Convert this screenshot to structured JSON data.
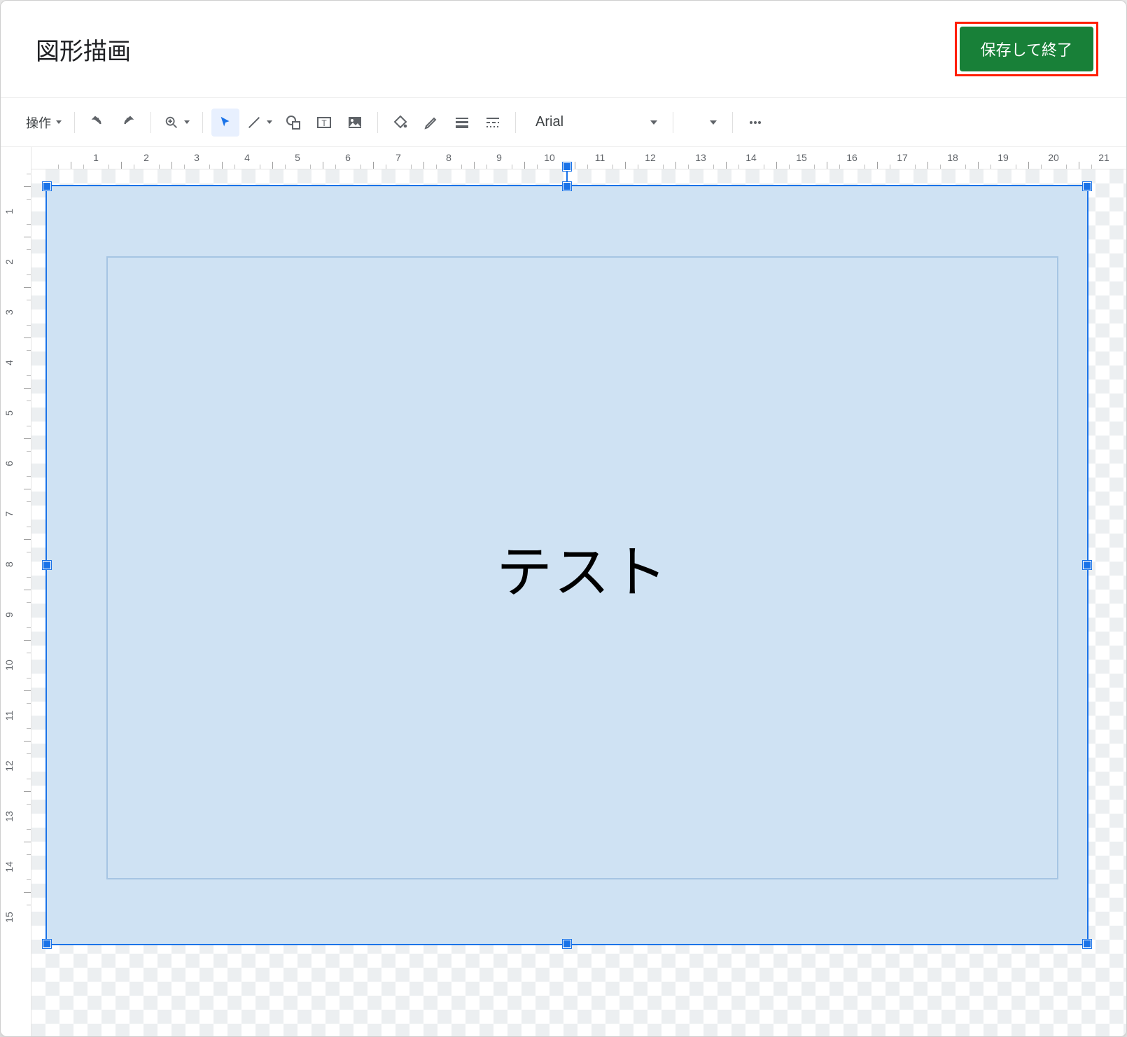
{
  "dialog": {
    "title": "図形描画",
    "save_button": "保存して終了"
  },
  "toolbar": {
    "actions_label": "操作",
    "font_name": "Arial"
  },
  "ruler": {
    "h_labels": [
      "1",
      "2",
      "3",
      "4",
      "5",
      "6",
      "7",
      "8",
      "9",
      "10",
      "11",
      "12",
      "13",
      "14",
      "15",
      "16",
      "17",
      "18",
      "19",
      "20",
      "21"
    ],
    "v_labels": [
      "1",
      "2",
      "3",
      "4",
      "5",
      "6",
      "7",
      "8",
      "9",
      "10",
      "11",
      "12",
      "13",
      "14",
      "15"
    ]
  },
  "shape": {
    "text": "テスト"
  },
  "colors": {
    "accent": "#1a73e8",
    "save_button": "#188038",
    "highlight_box": "#ff1e00",
    "shape_fill": "#cfe2f3"
  }
}
